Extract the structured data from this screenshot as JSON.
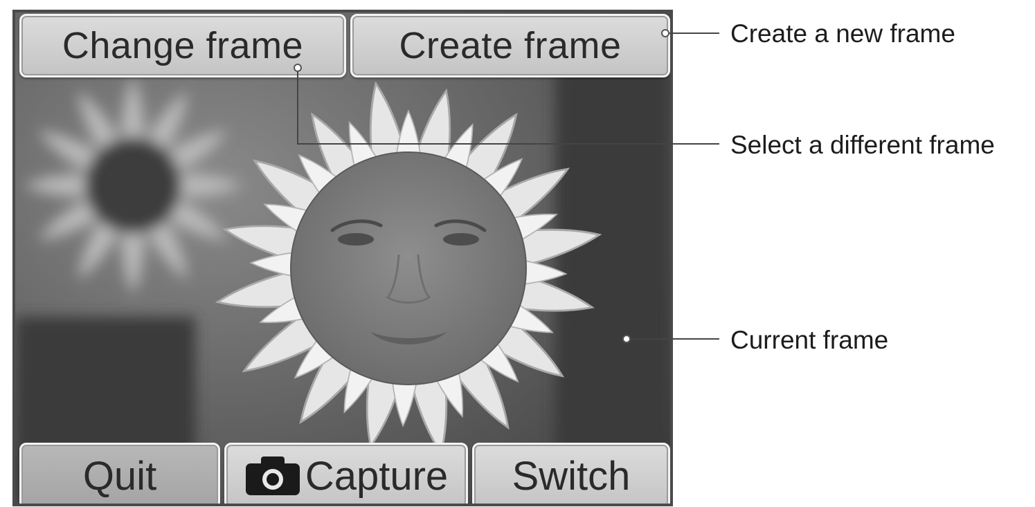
{
  "screen": {
    "top_buttons": {
      "change_frame": "Change frame",
      "create_frame": "Create frame"
    },
    "bottom_buttons": {
      "quit": "Quit",
      "capture": "Capture",
      "switch": "Switch"
    },
    "capture_icon": "camera-icon"
  },
  "callouts": {
    "create": "Create a new frame",
    "select": "Select a different frame",
    "current": "Current frame"
  },
  "colors": {
    "button_face": "#d0d0d0",
    "button_border": "#f4f4f4",
    "text": "#2a2a2a"
  }
}
